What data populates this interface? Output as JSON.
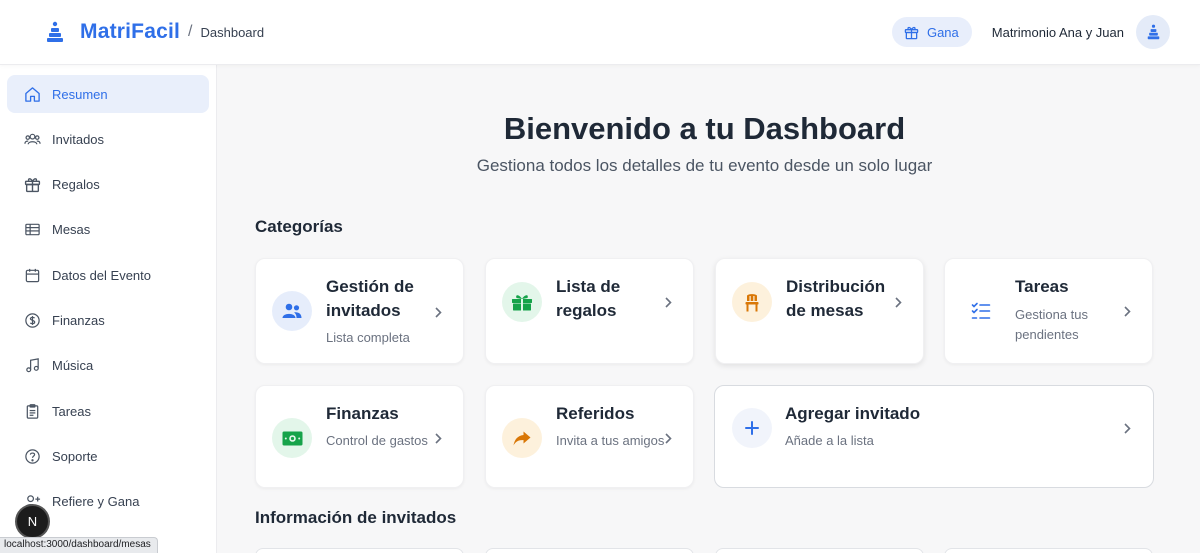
{
  "header": {
    "brand": "MatriFacil",
    "separator": "/",
    "page": "Dashboard",
    "gana_label": "Gana",
    "user_name": "Matrimonio Ana y Juan"
  },
  "sidebar": {
    "items": [
      {
        "label": "Resumen",
        "icon": "home-icon",
        "active": true
      },
      {
        "label": "Invitados",
        "icon": "users-icon"
      },
      {
        "label": "Regalos",
        "icon": "gift-icon"
      },
      {
        "label": "Mesas",
        "icon": "table-icon"
      },
      {
        "label": "Datos del Evento",
        "icon": "calendar-icon"
      },
      {
        "label": "Finanzas",
        "icon": "dollar-icon"
      },
      {
        "label": "Música",
        "icon": "music-icon"
      },
      {
        "label": "Tareas",
        "icon": "clipboard-icon"
      },
      {
        "label": "Soporte",
        "icon": "help-icon"
      },
      {
        "label": "Refiere y Gana",
        "icon": "user-plus-icon"
      }
    ]
  },
  "main": {
    "title": "Bienvenido a tu Dashboard",
    "subtitle": "Gestiona todos los detalles de tu evento desde un solo lugar",
    "categories_title": "Categorías",
    "cards": [
      {
        "title": "Gestión de invitados",
        "description": "Lista completa",
        "icon": "users-icon"
      },
      {
        "title": "Lista de regalos",
        "description": "",
        "icon": "gift-icon"
      },
      {
        "title": "Distribución de mesas",
        "description": "",
        "icon": "chair-icon"
      },
      {
        "title": "Tareas",
        "description": "Gestiona tus pendientes",
        "icon": "checklist-icon"
      },
      {
        "title": "Finanzas",
        "description": "Control de gastos",
        "icon": "money-icon"
      },
      {
        "title": "Referidos",
        "description": "Invita a tus amigos",
        "icon": "share-arrow-icon"
      },
      {
        "title": "Agregar invitado",
        "description": "Añade a la lista",
        "icon": "plus-icon"
      }
    ],
    "guest_info_title": "Información de invitados"
  },
  "status_bar": {
    "url": "localhost:3000/dashboard/mesas"
  },
  "overlay": {
    "next_badge": "N"
  },
  "colors": {
    "accent": "#2f6fe8",
    "active_bg": "#e9effb",
    "green": "#16a34a",
    "orange": "#d97706"
  }
}
